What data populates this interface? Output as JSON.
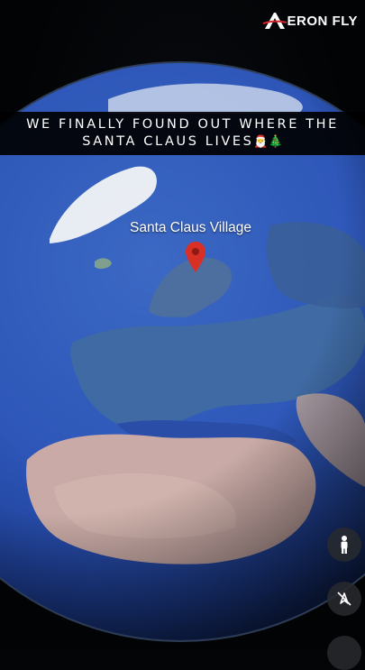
{
  "brand": {
    "name": "ERON FLY",
    "mark": "A"
  },
  "caption": {
    "line1": "WE FINALLY FOUND OUT WHERE THE",
    "line2": "SANTA CLAUS LIVES",
    "emojis": "🎅🎄"
  },
  "map": {
    "marker_label": "Santa Claus Village",
    "marker_color": "#d93025",
    "ocean_color": "#2d56b8",
    "land_color": "#3b6aa6",
    "desert_color": "#c7a8a3"
  },
  "controls": [
    {
      "icon": "pegman-icon"
    },
    {
      "icon": "compass-icon"
    }
  ]
}
